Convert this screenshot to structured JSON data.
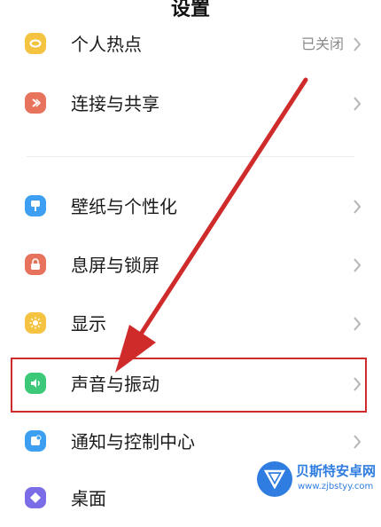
{
  "header": {
    "title": "设置"
  },
  "items": [
    {
      "id": "hotspot",
      "label": "个人热点",
      "value": "已关闭",
      "icon": "hotspot-icon",
      "color": "#f5c342"
    },
    {
      "id": "connect",
      "label": "连接与共享",
      "icon": "share-icon",
      "color": "#e8735d"
    },
    {
      "id": "wallpaper",
      "label": "壁纸与个性化",
      "icon": "brush-icon",
      "color": "#3d9ff2"
    },
    {
      "id": "lockscreen",
      "label": "息屏与锁屏",
      "icon": "lock-icon",
      "color": "#e8735d"
    },
    {
      "id": "display",
      "label": "显示",
      "icon": "sun-icon",
      "color": "#f5c342"
    },
    {
      "id": "sound",
      "label": "声音与振动",
      "icon": "speaker-icon",
      "color": "#3ec97a"
    },
    {
      "id": "notify",
      "label": "通知与控制中心",
      "icon": "notification-icon",
      "color": "#3d9ff2"
    },
    {
      "id": "desktop",
      "label": "桌面",
      "icon": "desktop-icon",
      "color": "#7b6ce8"
    }
  ],
  "watermark": {
    "name": "贝斯特安卓网",
    "url": "www.zjbstyy.com"
  },
  "colors": {
    "annotation": "#d02b2b",
    "chevron": "#b5b5b5"
  }
}
